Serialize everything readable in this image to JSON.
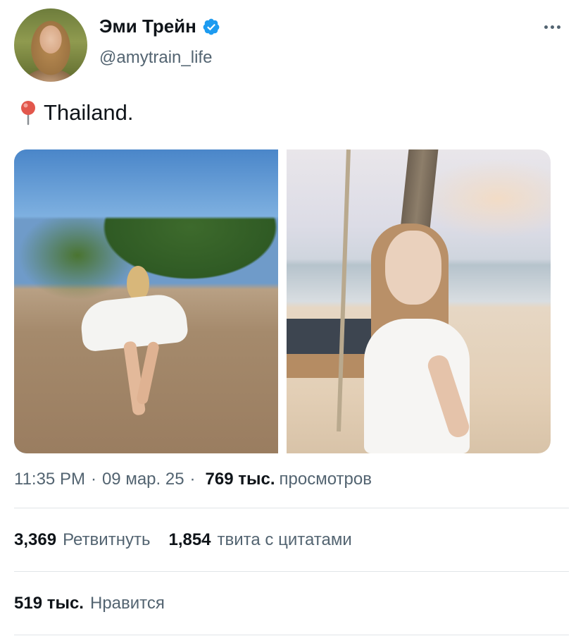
{
  "author": {
    "name": "Эми Трейн",
    "handle": "@amytrain_life",
    "verified": true
  },
  "tweet": {
    "text": "Thailand.",
    "location_icon": "round-pushpin-icon"
  },
  "media": {
    "count": 2,
    "photos": [
      "beach-photo-1",
      "beach-photo-2"
    ]
  },
  "meta": {
    "time": "11:35 PM",
    "separator": "·",
    "date": "09 мар. 25",
    "views_count": "769 тыс.",
    "views_label": "просмотров"
  },
  "stats": {
    "retweets_count": "3,369",
    "retweets_label": "Ретвитнуть",
    "quotes_count": "1,854",
    "quotes_label": "твита с цитатами",
    "likes_count": "519 тыс.",
    "likes_label": "Нравится"
  },
  "colors": {
    "text_primary": "#0f1419",
    "text_secondary": "#536471",
    "verified_blue": "#1d9bf0",
    "divider": "#e1e5e8"
  }
}
